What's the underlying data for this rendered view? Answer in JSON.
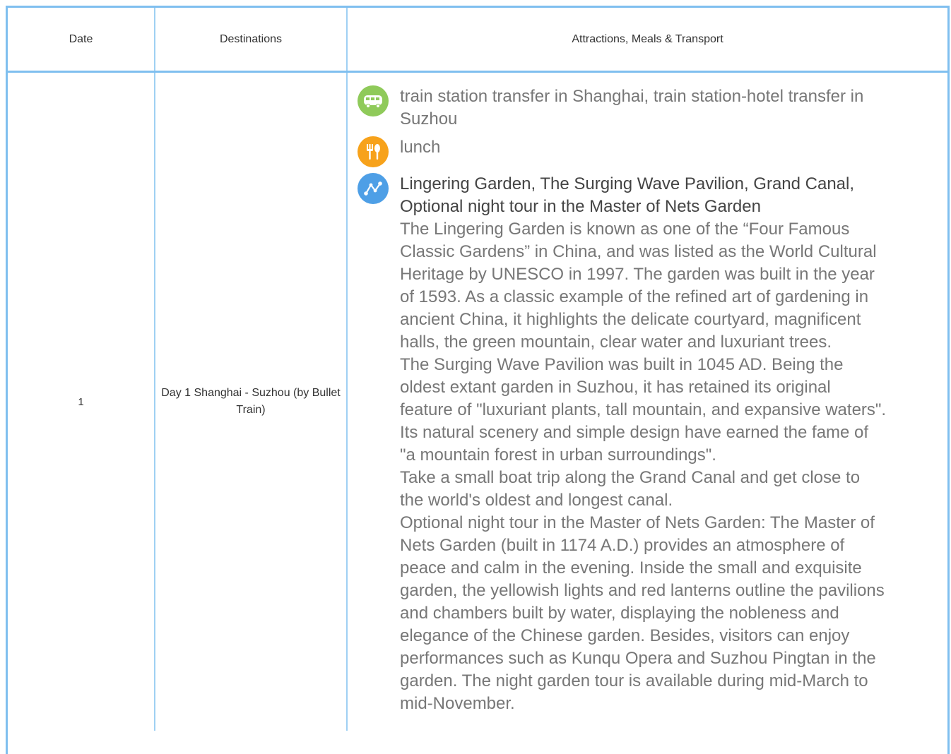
{
  "table": {
    "headers": {
      "date": "Date",
      "destinations": "Destinations",
      "attractions": "Attractions, Meals & Transport"
    },
    "rows": [
      {
        "date": "1",
        "destination": "Day 1 Shanghai - Suzhou (by Bullet Train)",
        "transport": "train station transfer in Shanghai, train station-hotel transfer in Suzhou",
        "meal": "lunch",
        "attractions_title": "Lingering Garden, The Surging Wave Pavilion, Grand Canal, Optional night tour in the Master of Nets Garden",
        "paragraphs": [
          "The Lingering Garden is known as one of the “Four Famous Classic Gardens” in China, and was listed as the World Cultural Heritage by UNESCO in 1997. The garden was built in the year of 1593. As a classic example of the refined art of gardening in ancient China, it highlights the delicate courtyard, magnificent halls, the green mountain, clear water and luxuriant trees.",
          "The Surging Wave Pavilion was built in 1045 AD. Being the oldest extant garden in Suzhou, it has retained its original feature of \"luxuriant plants, tall mountain, and expansive waters\". Its natural scenery and simple design have earned the fame of \"a mountain forest in urban surroundings\".",
          "Take a small boat trip along the Grand Canal and get close to the world's oldest and longest canal.",
          "Optional night tour in the Master of Nets Garden: The Master of Nets Garden (built in 1174 A.D.) provides an atmosphere of peace and calm in the evening. Inside the small and exquisite garden, the yellowish lights and red lanterns outline the pavilions and chambers built by water, displaying the nobleness and elegance of the Chinese garden. Besides, visitors can enjoy performances such as Kunqu Opera and Suzhou Pingtan in the garden. The night garden tour is available during mid-March to mid-November."
        ]
      }
    ]
  },
  "icons": {
    "transport": "bus-icon",
    "meal": "fork-spoon-icon",
    "attractions": "route-icon"
  },
  "colors": {
    "border": "#7fbfef",
    "bus_icon_bg": "#8fca5a",
    "meal_icon_bg": "#f7a21b",
    "route_icon_bg": "#4e9fe6"
  }
}
